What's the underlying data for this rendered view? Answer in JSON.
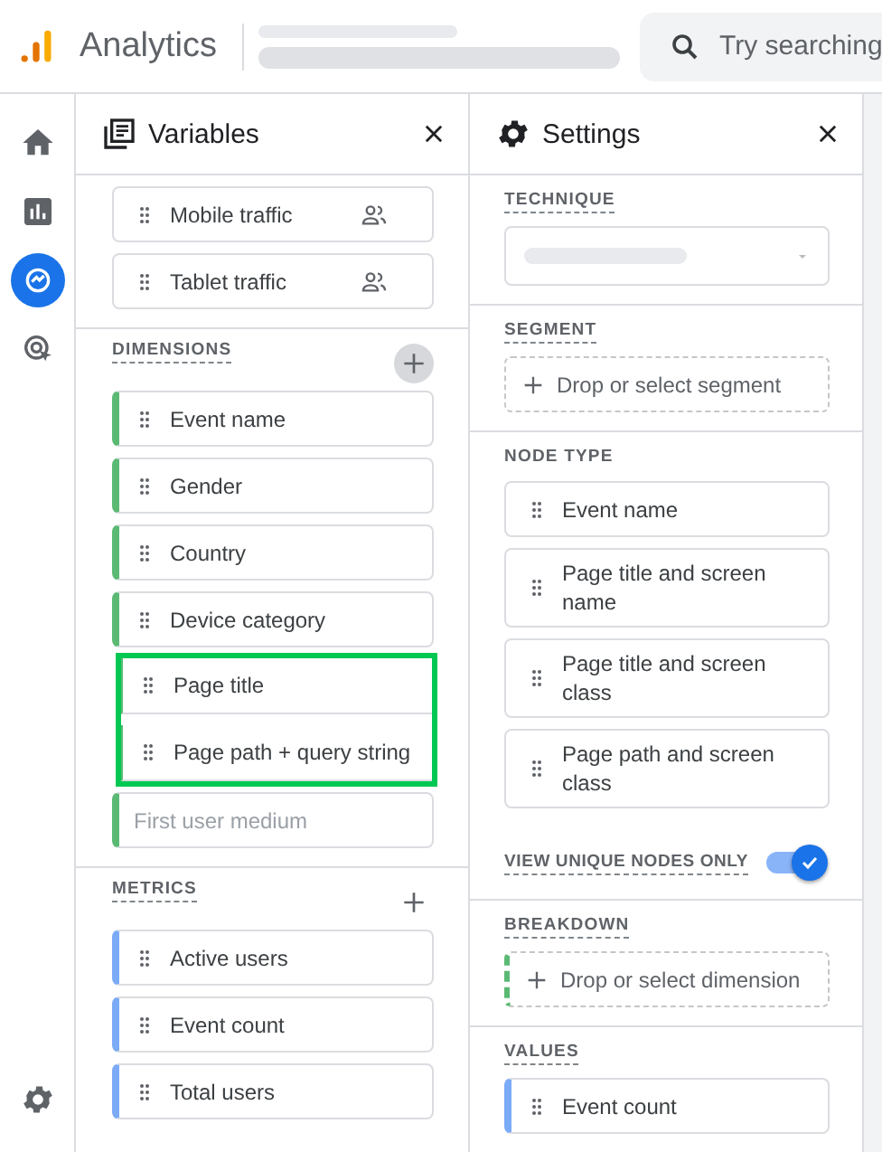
{
  "app": {
    "name": "Analytics",
    "search": {
      "placeholder": "Try searching"
    }
  },
  "nav": [
    {
      "selected": false
    },
    {
      "selected": false
    },
    {
      "selected": true
    },
    {
      "selected": false
    }
  ],
  "variables": {
    "title": "Variables",
    "sections": [
      {
        "kind": "segments",
        "items": [
          {
            "label": "Mobile traffic",
            "kind": "segment"
          },
          {
            "label": "Tablet traffic",
            "kind": "segment"
          }
        ]
      },
      {
        "kind": "dimensions",
        "heading": "DIMENSIONS",
        "add_emphasized": true,
        "items": [
          {
            "label": "Event name",
            "kind": "item",
            "highlighted": false
          },
          {
            "label": "Gender",
            "kind": "item",
            "highlighted": false
          },
          {
            "label": "Country",
            "kind": "item",
            "highlighted": false
          },
          {
            "label": "Device category",
            "kind": "item",
            "highlighted": false
          },
          {
            "label": "Page title",
            "kind": "item",
            "highlighted": true
          },
          {
            "label": "Page path + query string",
            "kind": "item",
            "highlighted": true
          },
          {
            "label": "First user medium",
            "kind": "placeholder",
            "highlighted": false
          }
        ]
      },
      {
        "kind": "metrics",
        "heading": "METRICS",
        "add_emphasized": false,
        "items": [
          {
            "label": "Active users",
            "kind": "item",
            "highlighted": false
          },
          {
            "label": "Event count",
            "kind": "item",
            "highlighted": false
          },
          {
            "label": "Total users",
            "kind": "item",
            "highlighted": false
          }
        ]
      }
    ]
  },
  "settings": {
    "title": "Settings",
    "sections": [
      {
        "heading": "TECHNIQUE",
        "underlined": true,
        "kind": "dropdown"
      },
      {
        "heading": "SEGMENT",
        "underlined": true,
        "kind": "dropzone",
        "text": "Drop or select segment"
      },
      {
        "heading": "NODE TYPE",
        "underlined": false,
        "kind": "cards",
        "items": [
          "Event name",
          "Page title and screen name",
          "Page title and screen class",
          "Page path and screen class"
        ],
        "toggle": {
          "label": "VIEW UNIQUE NODES ONLY",
          "on": true
        }
      },
      {
        "heading": "BREAKDOWN",
        "underlined": true,
        "kind": "dimension-dropzone",
        "text": "Drop or select dimension"
      },
      {
        "heading": "VALUES",
        "underlined": true,
        "kind": "metric-cards",
        "items": [
          "Event count"
        ]
      }
    ]
  }
}
